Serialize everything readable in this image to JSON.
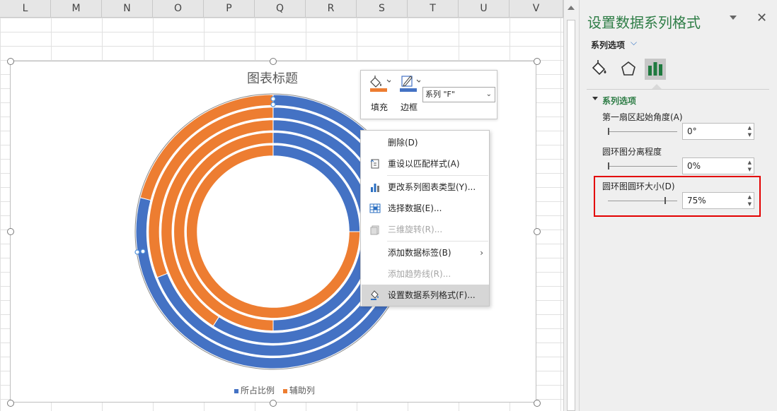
{
  "sheet": {
    "columns": [
      "L",
      "M",
      "N",
      "O",
      "P",
      "Q",
      "R",
      "S",
      "T",
      "U",
      "V"
    ]
  },
  "chart": {
    "title": "图表标题",
    "legend": [
      {
        "label": "所占比例",
        "color": "#4472c4"
      },
      {
        "label": "辅助列",
        "color": "#ed7d31"
      }
    ]
  },
  "chart_data": {
    "type": "doughnut",
    "title": "图表标题",
    "hole_size_percent": 75,
    "rings": [
      {
        "所占比例": 0.79,
        "辅助列": 0.21
      },
      {
        "所占比例": 0.69,
        "辅助列": 0.31
      },
      {
        "所占比例": 0.59,
        "辅助列": 0.41
      },
      {
        "所占比例": 0.5,
        "辅助列": 0.5
      },
      {
        "所占比例": 0.25,
        "辅助列": 0.75
      }
    ],
    "series_colors": {
      "所占比例": "#4472c4",
      "辅助列": "#ed7d31"
    }
  },
  "mini_toolbar": {
    "fill_label": "填充",
    "border_label": "边框",
    "series_select_value": "系列 \"F\""
  },
  "context_menu": {
    "items": [
      {
        "label": "删除(D)",
        "icon": "delete-icon",
        "enabled": true
      },
      {
        "label": "重设以匹配样式(A)",
        "icon": "reset-style-icon",
        "enabled": true
      },
      {
        "label": "更改系列图表类型(Y)...",
        "icon": "change-chart-type-icon",
        "enabled": true
      },
      {
        "label": "选择数据(E)...",
        "icon": "select-data-icon",
        "enabled": true
      },
      {
        "label": "三维旋转(R)...",
        "icon": "3d-rotation-icon",
        "enabled": false
      },
      {
        "label": "添加数据标签(B)",
        "icon": "",
        "enabled": true,
        "submenu": true
      },
      {
        "label": "添加趋势线(R)...",
        "icon": "",
        "enabled": false
      },
      {
        "label": "设置数据系列格式(F)...",
        "icon": "format-series-icon",
        "enabled": true,
        "highlighted": true
      }
    ]
  },
  "pane": {
    "title": "设置数据系列格式",
    "close": "✕",
    "series_options_link": "系列选项",
    "section_header": "系列选项",
    "first_slice_label": "第一扇区起始角度(A)",
    "first_slice_value": "0°",
    "first_slice_level": 0,
    "explosion_label": "圆环图分离程度",
    "explosion_value": "0%",
    "explosion_level": 0,
    "hole_size_label": "圆环图圆环大小(D)",
    "hole_size_value": "75%",
    "hole_size_level": 0.75
  },
  "colors": {
    "accent_green": "#2e7d46",
    "series_blue": "#4472c4",
    "series_orange": "#ed7d31",
    "highlight_red": "#e30000"
  }
}
